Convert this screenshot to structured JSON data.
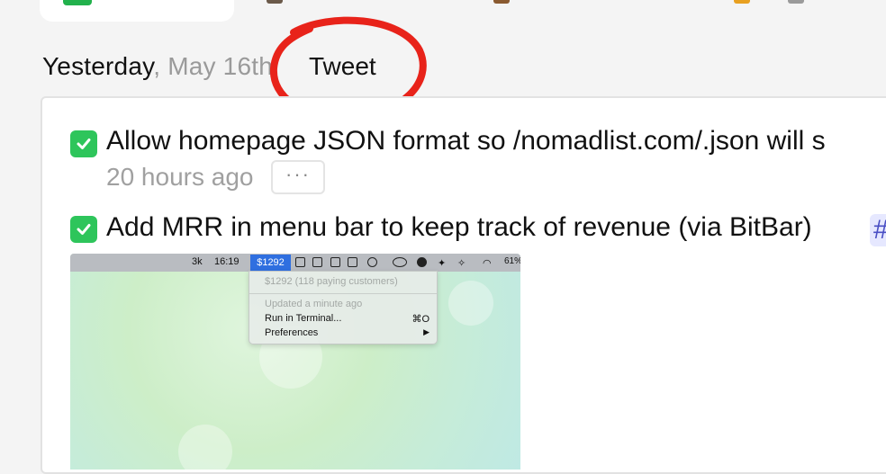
{
  "day": {
    "name": "Yesterday",
    "separator": ",",
    "date": "May 16th"
  },
  "tweet_label": "Tweet",
  "tasks": [
    {
      "text": "Allow homepage JSON format so /nomadlist.com/.json will s",
      "time": "20 hours ago",
      "more_label": "···"
    },
    {
      "text": "Add MRR in menu bar to keep track of revenue (via BitBar)",
      "tag": "#"
    }
  ],
  "screenshot": {
    "menubar": {
      "count": "3k",
      "time": "16:19",
      "mrr": "$1292",
      "battery": "61%"
    },
    "dropdown": {
      "summary": "$1292 (118 paying customers)",
      "updated": "Updated a minute ago",
      "run": "Run in Terminal...",
      "run_shortcut": "⌘O",
      "prefs": "Preferences",
      "prefs_arrow": "▶"
    }
  },
  "colors": {
    "check_green": "#2ec55b",
    "annotation_red": "#e8231a",
    "highlight_blue": "#2f6fe0",
    "date_gray": "#9a9a9a"
  }
}
